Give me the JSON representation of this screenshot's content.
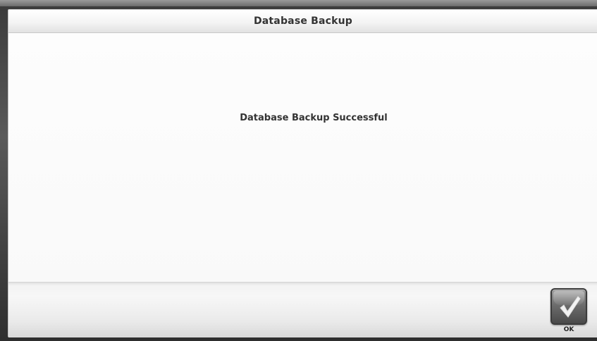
{
  "dialog": {
    "title": "Database Backup",
    "message": "Database Backup Successful"
  },
  "footer": {
    "ok_button": {
      "label": "OK",
      "icon": "checkmark-icon"
    }
  },
  "colors": {
    "title_text": "#333333",
    "message_text": "#333333",
    "dialog_background": "#f9f9f9",
    "button_dark": "#4a4a4a"
  }
}
